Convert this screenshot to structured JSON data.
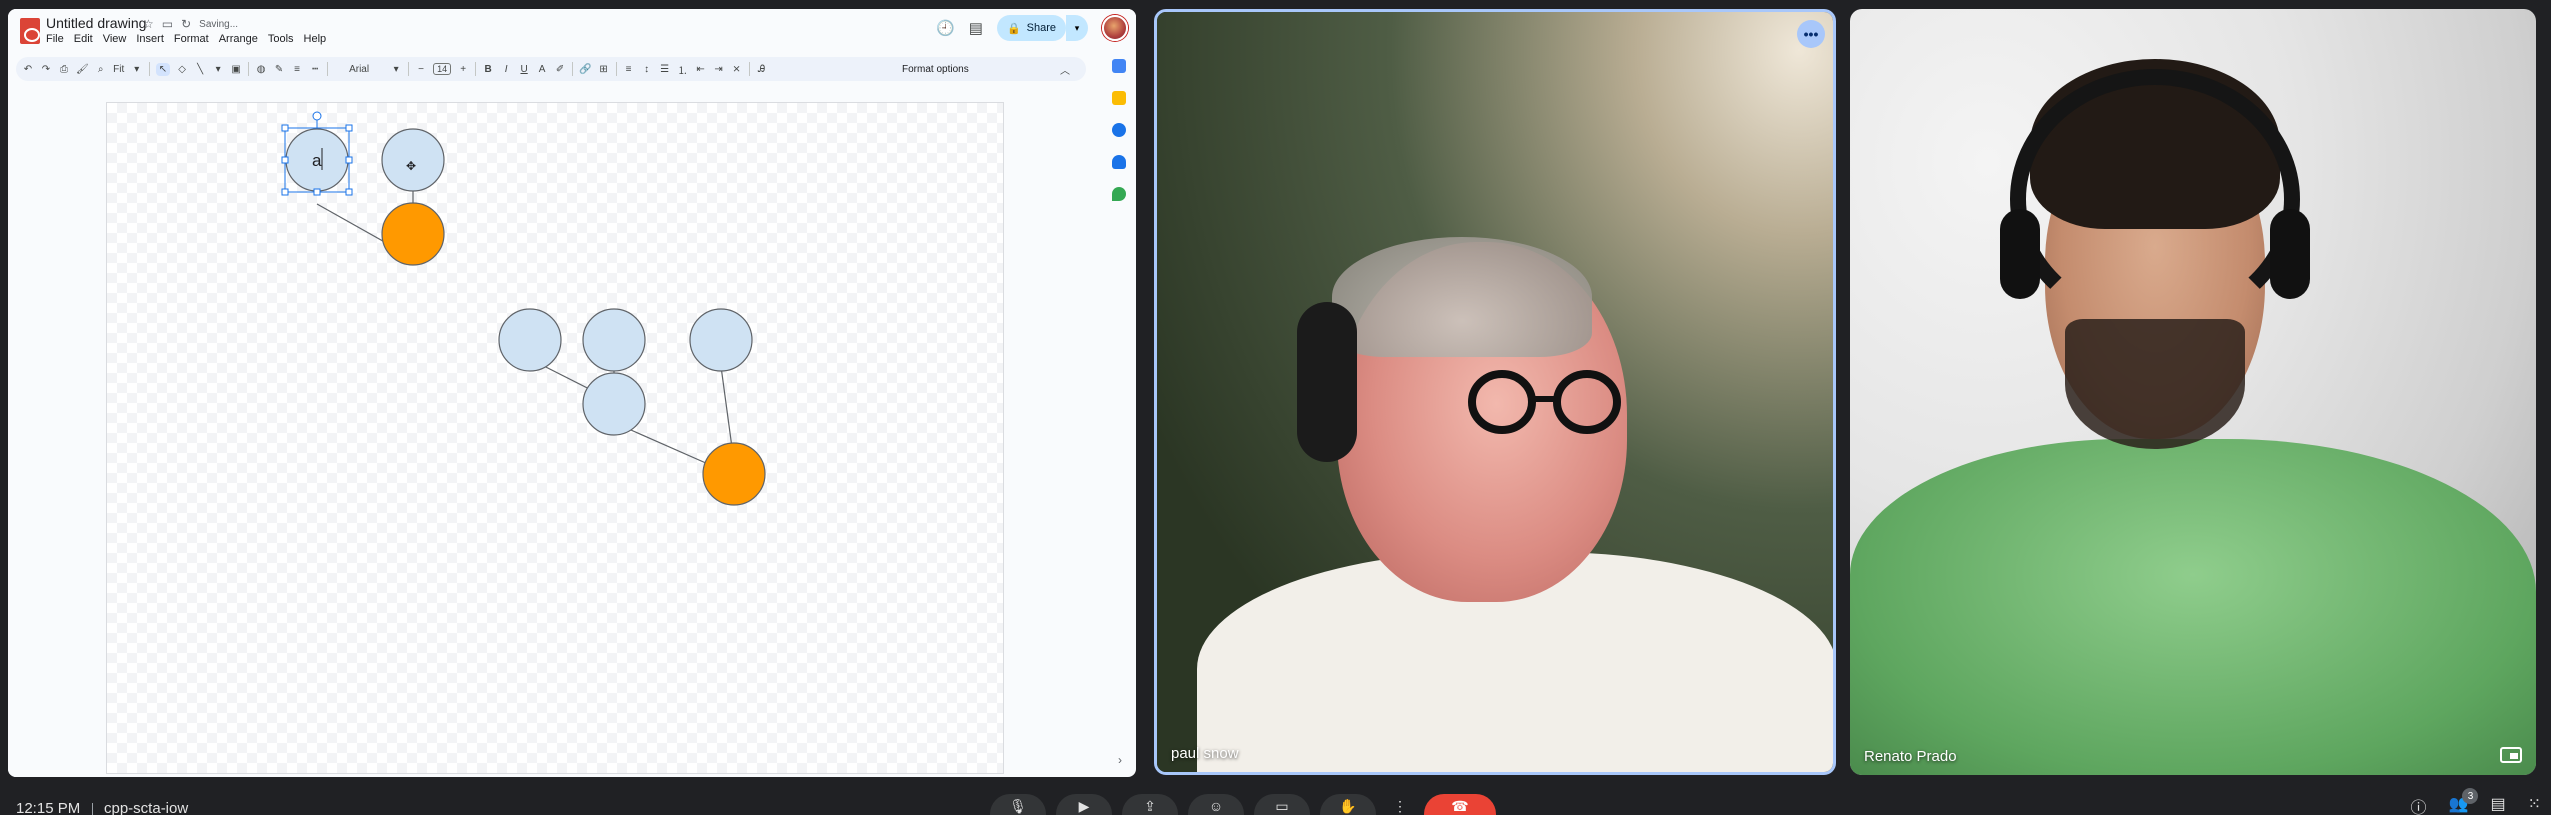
{
  "drawing": {
    "title": "Untitled drawing",
    "saving_status": "Saving...",
    "menu": [
      "File",
      "Edit",
      "View",
      "Insert",
      "Format",
      "Arrange",
      "Tools",
      "Help"
    ],
    "share_label": "Share",
    "toolbar": {
      "zoom": "Fit",
      "font": "Arial",
      "font_size": "14",
      "format_options": "Format options"
    },
    "selected_shape_text": "a",
    "colors": {
      "node_fill": "#cfe2f3",
      "accent_fill": "#ff9900",
      "stroke": "#5f6368",
      "selection": "#1a73e8"
    }
  },
  "meeting": {
    "participants": [
      {
        "name": "paul snow"
      },
      {
        "name": "Renato Prado"
      }
    ],
    "clock": "12:15 PM",
    "meeting_code": "cpp-scta-iow",
    "participant_count": "3",
    "colors": {
      "active_border": "#a8c7fa",
      "end_call": "#ea4335"
    }
  }
}
